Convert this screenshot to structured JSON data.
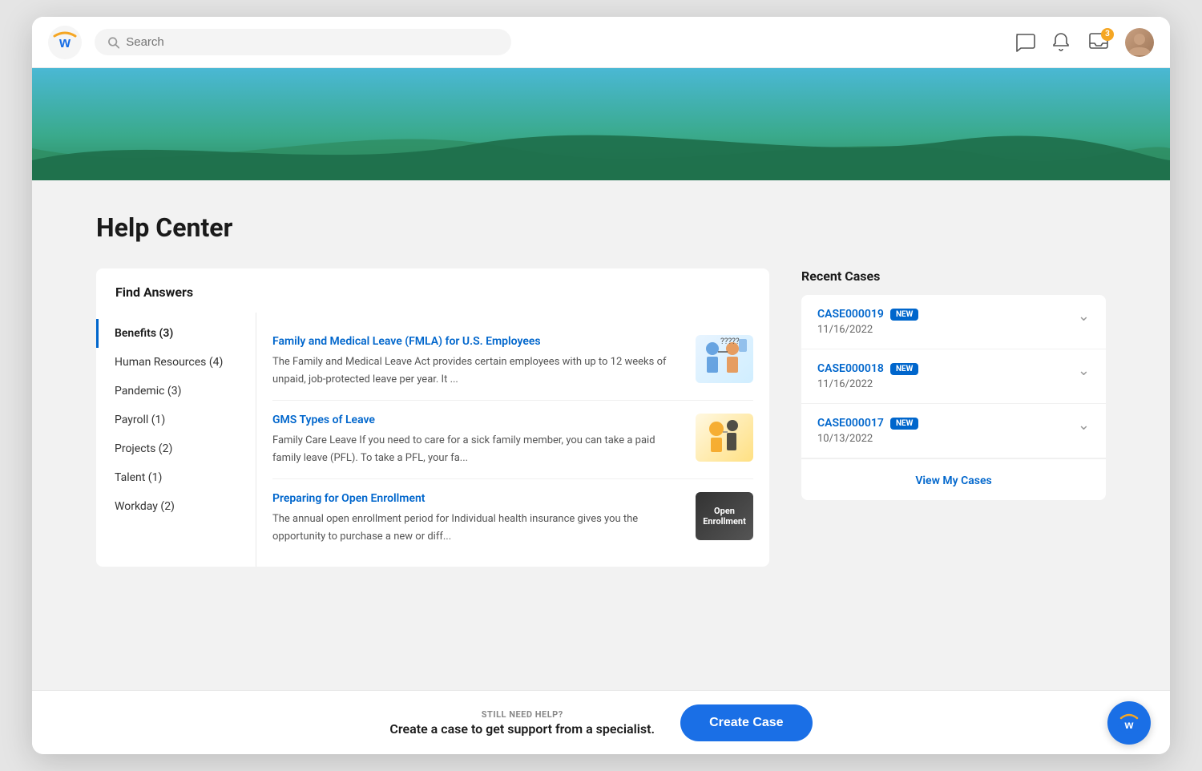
{
  "app": {
    "title": "Workday Help Center"
  },
  "nav": {
    "search_placeholder": "Search",
    "badge_count": "3",
    "icons": {
      "chat": "💬",
      "bell": "🔔",
      "inbox": "📥"
    }
  },
  "hero": {},
  "page": {
    "title": "Help Center"
  },
  "find_answers": {
    "section_title": "Find Answers",
    "categories": [
      {
        "label": "Benefits (3)",
        "active": true
      },
      {
        "label": "Human Resources (4)",
        "active": false
      },
      {
        "label": "Pandemic (3)",
        "active": false
      },
      {
        "label": "Payroll (1)",
        "active": false
      },
      {
        "label": "Projects (2)",
        "active": false
      },
      {
        "label": "Talent (1)",
        "active": false
      },
      {
        "label": "Workday (2)",
        "active": false
      }
    ],
    "articles": [
      {
        "title": "Family and Medical Leave (FMLA) for U.S. Employees",
        "description": "The Family and Medical Leave Act provides certain employees with up to 12 weeks of unpaid, job-protected leave per year. It ...",
        "thumb_type": "fmla"
      },
      {
        "title": "GMS Types of Leave",
        "description": "Family Care Leave If you need to care for a sick family member, you can take a paid family leave (PFL). To take a PFL, your fa...",
        "thumb_type": "gms"
      },
      {
        "title": "Preparing for Open Enrollment",
        "description": "The annual open enrollment period for Individual health insurance gives you the opportunity to purchase a new or diff...",
        "thumb_type": "enroll"
      }
    ]
  },
  "recent_cases": {
    "section_title": "Recent Cases",
    "cases": [
      {
        "id": "CASE000019",
        "badge": "NEW",
        "date": "11/16/2022"
      },
      {
        "id": "CASE000018",
        "badge": "NEW",
        "date": "11/16/2022"
      },
      {
        "id": "CASE000017",
        "badge": "NEW",
        "date": "10/13/2022"
      }
    ],
    "view_all_label": "View My Cases"
  },
  "bottom_bar": {
    "still_need_label": "STILL NEED HELP?",
    "description": "Create a case to get support from a specialist.",
    "create_case_label": "Create Case"
  }
}
